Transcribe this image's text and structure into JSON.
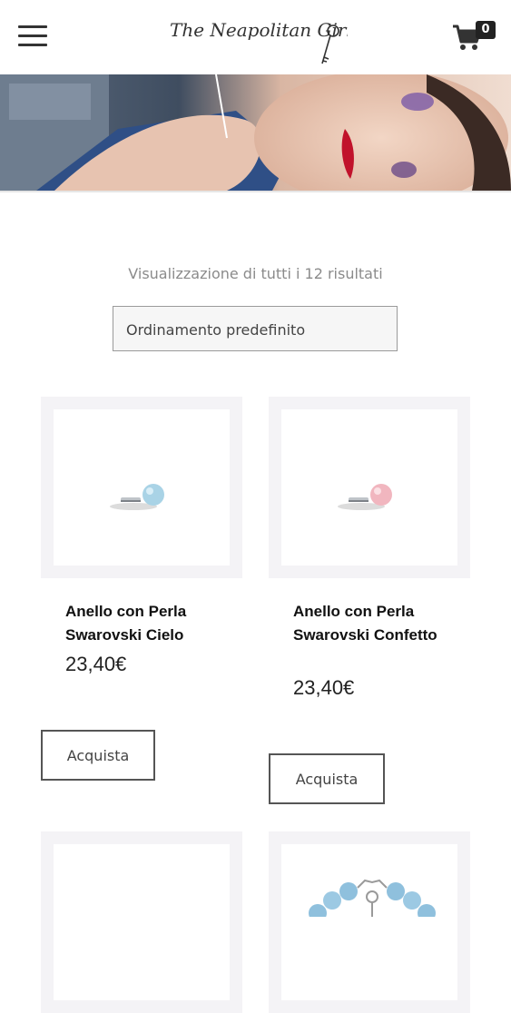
{
  "header": {
    "logo_text": "The Neapolitan Girl",
    "cart_count": "0"
  },
  "listing": {
    "result_count": "Visualizzazione di tutti i 12 risultati",
    "sort_selected": "Ordinamento predefinito"
  },
  "products": [
    {
      "title": "Anello con Perla Swarovski Cielo",
      "price": "23,40€",
      "button": "Acquista",
      "pearl_color": "#a9d3e6"
    },
    {
      "title": "Anello con Perla Swarovski Confetto",
      "price": "23,40€",
      "button": "Acquista",
      "pearl_color": "#f1b6bf"
    }
  ],
  "icons": {
    "menu": "hamburger-menu-icon",
    "cart": "shopping-cart-icon"
  },
  "colors": {
    "card_frame": "#f4f3f6",
    "button_border": "#555555",
    "secondary_text": "#8b8b8b"
  }
}
